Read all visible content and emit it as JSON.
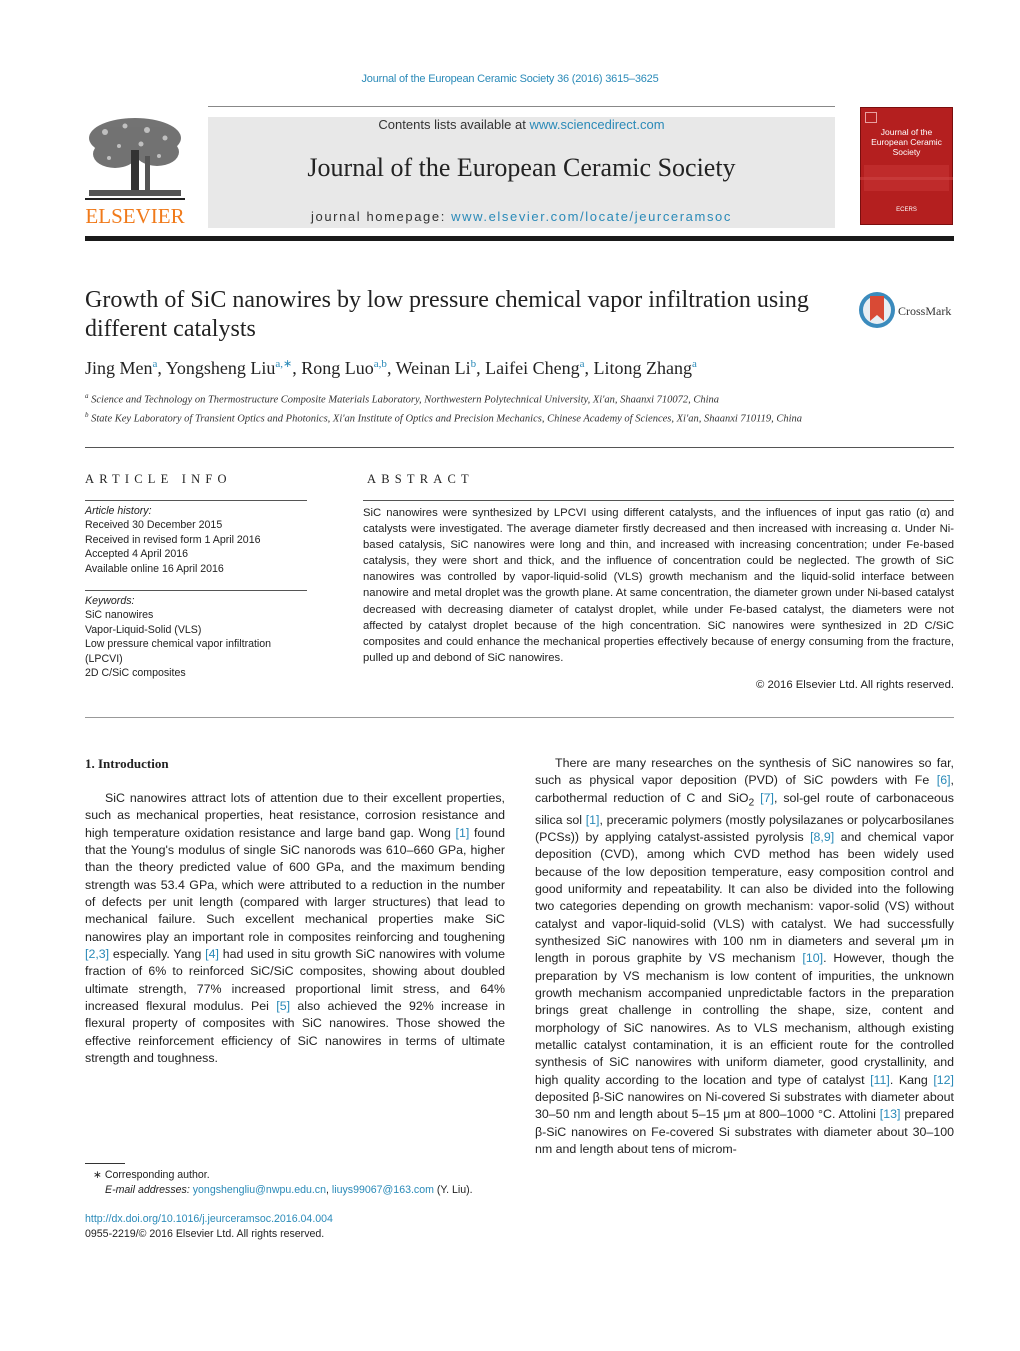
{
  "header": {
    "journal_ref": "Journal of the European Ceramic Society 36 (2016) 3615–3625",
    "contents_prefix": "Contents lists available at ",
    "contents_link": "www.sciencedirect.com",
    "journal_title": "Journal of the European Ceramic Society",
    "homepage_prefix": "journal homepage: ",
    "homepage_link": "www.elsevier.com/locate/jeurceramsoc",
    "publisher_logo": "ELSEVIER",
    "cover": {
      "title_line1": "Journal of the",
      "title_line2": "European Ceramic Society",
      "bottom_label": "ECERS",
      "color": "#b41f1f"
    },
    "publisher_color": "#f07a1a",
    "link_color": "#2a8ab8"
  },
  "article": {
    "title": "Growth of SiC nanowires by low pressure chemical vapor infiltration using different catalysts",
    "crossmark_label": "CrossMark",
    "authors": [
      {
        "name": "Jing Men",
        "sup": "a"
      },
      {
        "name": "Yongsheng Liu",
        "sup": "a,∗"
      },
      {
        "name": "Rong Luo",
        "sup": "a,b"
      },
      {
        "name": "Weinan Li",
        "sup": "b"
      },
      {
        "name": "Laifei Cheng",
        "sup": "a"
      },
      {
        "name": "Litong Zhang",
        "sup": "a"
      }
    ],
    "affiliations": [
      {
        "sup": "a",
        "text": "Science and Technology on Thermostructure Composite Materials Laboratory, Northwestern Polytechnical University, Xi'an, Shaanxi 710072, China"
      },
      {
        "sup": "b",
        "text": "State Key Laboratory of Transient Optics and Photonics, Xi'an Institute of Optics and Precision Mechanics, Chinese Academy of Sciences, Xi'an, Shaanxi 710119, China"
      }
    ]
  },
  "article_info": {
    "heading": "ARTICLE INFO",
    "history_label": "Article history:",
    "history": [
      "Received 30 December 2015",
      "Received in revised form 1 April 2016",
      "Accepted 4 April 2016",
      "Available online 16 April 2016"
    ],
    "keywords_label": "Keywords:",
    "keywords": [
      "SiC nanowires",
      "Vapor-Liquid-Solid (VLS)",
      "Low pressure chemical vapor infiltration (LPCVI)",
      "2D C/SiC composites"
    ]
  },
  "abstract": {
    "heading": "ABSTRACT",
    "text": "SiC nanowires were synthesized by LPCVI using different catalysts, and the influences of input gas ratio (α) and catalysts were investigated. The average diameter firstly decreased and then increased with increasing α. Under Ni-based catalysis, SiC nanowires were long and thin, and increased with increasing concentration; under Fe-based catalysis, they were short and thick, and the influence of concentration could be neglected. The growth of SiC nanowires was controlled by vapor-liquid-solid (VLS) growth mechanism and the liquid-solid interface between nanowire and metal droplet was the growth plane. At same concentration, the diameter grown under Ni-based catalyst decreased with decreasing diameter of catalyst droplet, while under Fe-based catalyst, the diameters were not affected by catalyst droplet because of the high concentration. SiC nanowires were synthesized in 2D C/SiC composites and could enhance the mechanical properties effectively because of energy consuming from the fracture, pulled up and debond of SiC nanowires.",
    "copyright": "© 2016 Elsevier Ltd. All rights reserved."
  },
  "body": {
    "section_heading": "1.  Introduction",
    "left_segments": [
      {
        "t": "SiC nanowires attract lots of attention due to their excellent properties, such as mechanical properties, heat resistance, corrosion resistance and high temperature oxidation resistance and large band gap. Wong "
      },
      {
        "ref": "[1]"
      },
      {
        "t": " found that the Young's modulus of single SiC nanorods was 610–660 GPa, higher than the theory predicted value of 600 GPa, and the maximum bending strength was 53.4 GPa, which were attributed to a reduction in the number of defects per unit length (compared with larger structures) that lead to mechanical failure. Such excellent mechanical properties make SiC nanowires play an important role in composites reinforcing and toughening "
      },
      {
        "ref": "[2,3]"
      },
      {
        "t": " especially. Yang "
      },
      {
        "ref": "[4]"
      },
      {
        "t": " had used in situ growth SiC nanowires with volume fraction of 6% to reinforced SiC/SiC composites, showing about doubled ultimate strength, 77% increased proportional limit stress, and 64% increased flexural modulus. Pei "
      },
      {
        "ref": "[5]"
      },
      {
        "t": " also achieved the 92% increase in flexural property of composites with SiC nanowires. Those showed the effective reinforcement efficiency of SiC nanowires in terms of ultimate strength and toughness."
      }
    ],
    "right_segments": [
      {
        "t": "There are many researches on the synthesis of SiC nanowires so far, such as physical vapor deposition (PVD) of SiC powders with Fe "
      },
      {
        "ref": "[6]"
      },
      {
        "t": ", carbothermal reduction of C and SiO"
      },
      {
        "sub": "2"
      },
      {
        "t": " "
      },
      {
        "ref": "[7]"
      },
      {
        "t": ", sol-gel route of carbonaceous silica sol "
      },
      {
        "ref": "[1]"
      },
      {
        "t": ", preceramic polymers (mostly polysilazanes or polycarbosilanes (PCSs)) by applying catalyst-assisted pyrolysis "
      },
      {
        "ref": "[8,9]"
      },
      {
        "t": " and chemical vapor deposition (CVD), among which CVD method has been widely used because of the low deposition temperature, easy composition control and good uniformity and repeatability. It can also be divided into the following two categories depending on growth mechanism: vapor-solid (VS) without catalyst and vapor-liquid-solid (VLS) with catalyst. We had successfully synthesized SiC nanowires with 100 nm in diameters and several μm in length in porous graphite by VS mechanism "
      },
      {
        "ref": "[10]"
      },
      {
        "t": ". However, though the preparation by VS mechanism is low content of impurities, the unknown growth mechanism accompanied unpredictable factors in the preparation brings great challenge in controlling the shape, size, content and morphology of SiC nanowires. As to VLS mechanism, although existing metallic catalyst contamination, it is an efficient route for the controlled synthesis of SiC nanowires with uniform diameter, good crystallinity, and high quality according to the location and type of catalyst "
      },
      {
        "ref": "[11]"
      },
      {
        "t": ". Kang "
      },
      {
        "ref": "[12]"
      },
      {
        "t": " deposited β-SiC nanowires on Ni-covered Si substrates with diameter about 30–50 nm and length about 5–15 μm at 800–1000 °C. Attolini "
      },
      {
        "ref": "[13]"
      },
      {
        "t": " prepared β-SiC nanowires on Fe-covered Si substrates with diameter about 30–100 nm and length about tens of microm-"
      }
    ]
  },
  "footnote": {
    "star": "∗",
    "corresponding": "Corresponding author.",
    "email_label": "E-mail addresses:",
    "email1": "yongshengliu@nwpu.edu.cn",
    "email2": "liuys99067@163.com",
    "email_suffix": "(Y. Liu).",
    "doi_link": "http://dx.doi.org/10.1016/j.jeurceramsoc.2016.04.004",
    "issn_line": "0955-2219/© 2016 Elsevier Ltd. All rights reserved."
  }
}
